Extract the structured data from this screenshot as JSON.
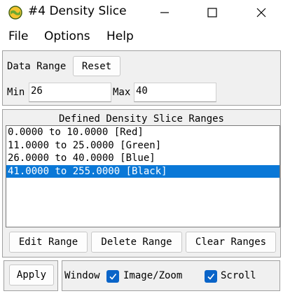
{
  "window": {
    "title": "#4 Density Slice"
  },
  "menu": {
    "file": "File",
    "options": "Options",
    "help": "Help"
  },
  "data_range": {
    "label": "Data Range",
    "reset_label": "Reset",
    "min_label": "Min",
    "min_value": "26",
    "max_label": "Max",
    "max_value": "40"
  },
  "ranges": {
    "title": "Defined Density Slice Ranges",
    "items": [
      "0.0000 to 10.0000 [Red]",
      "11.0000 to 25.0000 [Green]",
      "26.0000 to 40.0000 [Blue]",
      "41.0000 to 255.0000 [Black]"
    ],
    "selected_index": 3,
    "edit_label": "Edit Range",
    "delete_label": "Delete Range",
    "clear_label": "Clear Ranges"
  },
  "bottom": {
    "apply_label": "Apply",
    "window_label": "Window",
    "image_zoom_label": "Image/Zoom",
    "image_zoom_checked": true,
    "scroll_label": "Scroll",
    "scroll_checked": true
  },
  "colors": {
    "selection": "#0a78d7",
    "checkbox": "#0a64c8"
  }
}
